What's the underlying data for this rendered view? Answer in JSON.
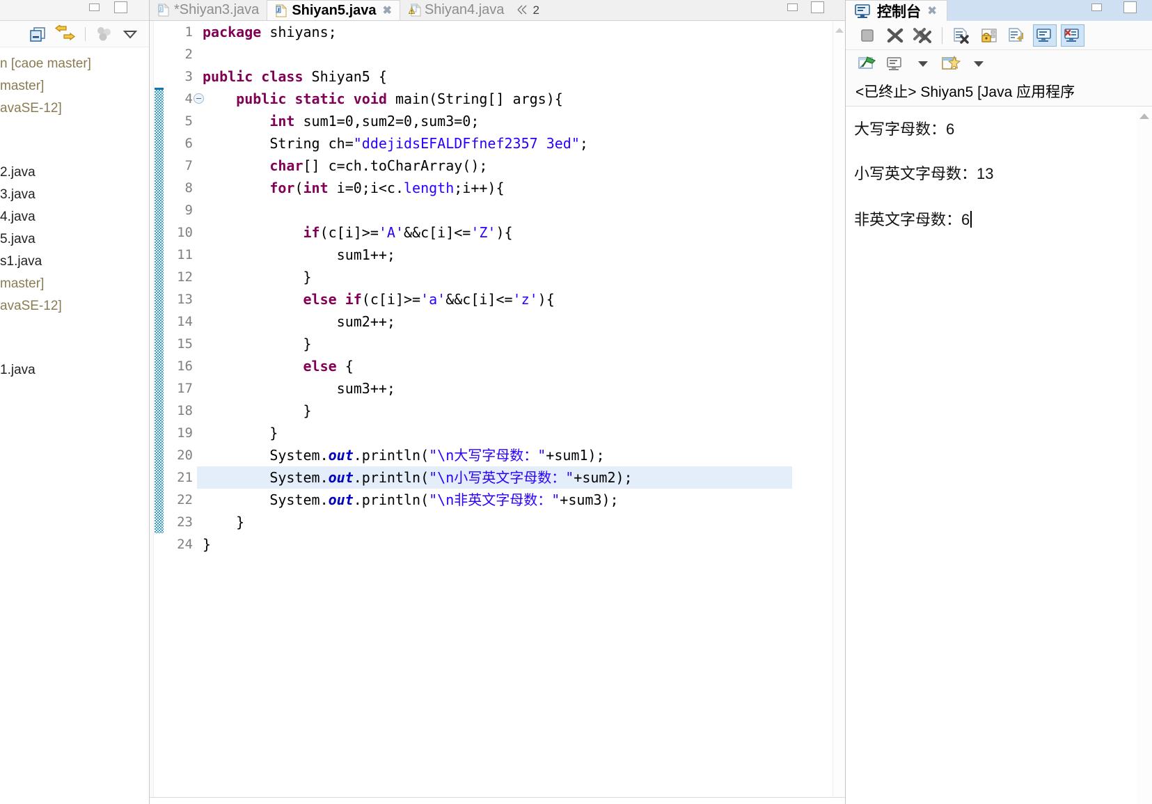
{
  "explorer": {
    "toolbar": [
      {
        "name": "collapse-all-icon",
        "label": "Collapse All"
      },
      {
        "name": "link-with-editor-icon",
        "label": "Link with Editor"
      },
      {
        "name": "view-menu-icon",
        "label": "View Menu"
      },
      {
        "name": "chevron-down-icon",
        "label": "More"
      }
    ],
    "tree": [
      {
        "label": "n [caoe master]",
        "style": "dim"
      },
      {
        "label": " master]",
        "style": "dim"
      },
      {
        "label": "avaSE-12]",
        "style": "dim"
      },
      {
        "label": "2.java",
        "style": "normal"
      },
      {
        "label": "3.java",
        "style": "normal"
      },
      {
        "label": "4.java",
        "style": "normal"
      },
      {
        "label": "5.java",
        "style": "selected"
      },
      {
        "label": "s1.java",
        "style": "normal"
      },
      {
        "label": " master]",
        "style": "dim"
      },
      {
        "label": "avaSE-12]",
        "style": "dim"
      },
      {
        "label": "1.java",
        "style": "normal"
      }
    ]
  },
  "editor": {
    "tabs": [
      {
        "label": "*Shiyan3.java",
        "active": false,
        "dirty": true,
        "warning": false,
        "closeable": false
      },
      {
        "label": "Shiyan5.java",
        "active": true,
        "dirty": false,
        "warning": false,
        "closeable": true
      },
      {
        "label": "Shiyan4.java",
        "active": false,
        "dirty": false,
        "warning": true,
        "closeable": false
      }
    ],
    "overflow_count": "2",
    "first_line": 1,
    "highlighted_line": 21,
    "change_bar_lines": [
      4,
      23
    ],
    "lines": [
      {
        "n": "1",
        "tokens": [
          {
            "t": "package ",
            "c": "kw"
          },
          {
            "t": "shiyans;",
            "c": "plain"
          }
        ]
      },
      {
        "n": "2",
        "tokens": []
      },
      {
        "n": "3",
        "tokens": [
          {
            "t": "public class ",
            "c": "kw"
          },
          {
            "t": "Shiyan5 {",
            "c": "plain"
          }
        ]
      },
      {
        "n": "4",
        "fold": true,
        "tokens": [
          {
            "t": "    ",
            "c": "plain"
          },
          {
            "t": "public static void ",
            "c": "kw"
          },
          {
            "t": "main(String[] args){",
            "c": "plain"
          }
        ]
      },
      {
        "n": "5",
        "tokens": [
          {
            "t": "        ",
            "c": "plain"
          },
          {
            "t": "int",
            "c": "kw"
          },
          {
            "t": " sum1=0,sum2=0,sum3=0;",
            "c": "plain"
          }
        ]
      },
      {
        "n": "6",
        "tokens": [
          {
            "t": "        String ch=",
            "c": "plain"
          },
          {
            "t": "\"ddejidsEFALDFfnef2357 3ed\"",
            "c": "str"
          },
          {
            "t": ";",
            "c": "plain"
          }
        ]
      },
      {
        "n": "7",
        "tokens": [
          {
            "t": "        ",
            "c": "plain"
          },
          {
            "t": "char",
            "c": "kw"
          },
          {
            "t": "[] c=ch.toCharArray();",
            "c": "plain"
          }
        ]
      },
      {
        "n": "8",
        "tokens": [
          {
            "t": "        ",
            "c": "plain"
          },
          {
            "t": "for",
            "c": "kw"
          },
          {
            "t": "(",
            "c": "plain"
          },
          {
            "t": "int",
            "c": "kw"
          },
          {
            "t": " i=0;i<c.",
            "c": "plain"
          },
          {
            "t": "length",
            "c": "str"
          },
          {
            "t": ";i++){",
            "c": "plain"
          }
        ]
      },
      {
        "n": "9",
        "tokens": []
      },
      {
        "n": "10",
        "tokens": [
          {
            "t": "            ",
            "c": "plain"
          },
          {
            "t": "if",
            "c": "kw"
          },
          {
            "t": "(c[i]>=",
            "c": "plain"
          },
          {
            "t": "'A'",
            "c": "str"
          },
          {
            "t": "&&c[i]<=",
            "c": "plain"
          },
          {
            "t": "'Z'",
            "c": "str"
          },
          {
            "t": "){",
            "c": "plain"
          }
        ]
      },
      {
        "n": "11",
        "tokens": [
          {
            "t": "                sum1++;",
            "c": "plain"
          }
        ]
      },
      {
        "n": "12",
        "tokens": [
          {
            "t": "            }",
            "c": "plain"
          }
        ]
      },
      {
        "n": "13",
        "tokens": [
          {
            "t": "            ",
            "c": "plain"
          },
          {
            "t": "else if",
            "c": "kw"
          },
          {
            "t": "(c[i]>=",
            "c": "plain"
          },
          {
            "t": "'a'",
            "c": "str"
          },
          {
            "t": "&&c[i]<=",
            "c": "plain"
          },
          {
            "t": "'z'",
            "c": "str"
          },
          {
            "t": "){",
            "c": "plain"
          }
        ]
      },
      {
        "n": "14",
        "tokens": [
          {
            "t": "                sum2++;",
            "c": "plain"
          }
        ]
      },
      {
        "n": "15",
        "tokens": [
          {
            "t": "            }",
            "c": "plain"
          }
        ]
      },
      {
        "n": "16",
        "tokens": [
          {
            "t": "            ",
            "c": "plain"
          },
          {
            "t": "else",
            "c": "kw"
          },
          {
            "t": " {",
            "c": "plain"
          }
        ]
      },
      {
        "n": "17",
        "tokens": [
          {
            "t": "                sum3++;",
            "c": "plain"
          }
        ]
      },
      {
        "n": "18",
        "tokens": [
          {
            "t": "            }",
            "c": "plain"
          }
        ]
      },
      {
        "n": "19",
        "tokens": [
          {
            "t": "        }",
            "c": "plain"
          }
        ]
      },
      {
        "n": "20",
        "tokens": [
          {
            "t": "        System.",
            "c": "plain"
          },
          {
            "t": "out",
            "c": "field"
          },
          {
            "t": ".println(",
            "c": "plain"
          },
          {
            "t": "\"\\n大写字母数：\"",
            "c": "str"
          },
          {
            "t": "+sum1);",
            "c": "plain"
          }
        ]
      },
      {
        "n": "21",
        "tokens": [
          {
            "t": "        System.",
            "c": "plain"
          },
          {
            "t": "out",
            "c": "field"
          },
          {
            "t": ".println(",
            "c": "plain"
          },
          {
            "t": "\"\\n小写英文字母数：\"",
            "c": "str"
          },
          {
            "t": "+sum2);",
            "c": "plain"
          }
        ]
      },
      {
        "n": "22",
        "tokens": [
          {
            "t": "        System.",
            "c": "plain"
          },
          {
            "t": "out",
            "c": "field"
          },
          {
            "t": ".println(",
            "c": "plain"
          },
          {
            "t": "\"\\n非英文字母数：\"",
            "c": "str"
          },
          {
            "t": "+sum3);",
            "c": "plain"
          }
        ]
      },
      {
        "n": "23",
        "tokens": [
          {
            "t": "    }",
            "c": "plain"
          }
        ]
      },
      {
        "n": "24",
        "tokens": [
          {
            "t": "}",
            "c": "plain"
          }
        ]
      }
    ]
  },
  "console": {
    "tab_label": "控制台",
    "toolbar_row1": [
      {
        "name": "terminate-icon",
        "label": "Terminate",
        "active": false
      },
      {
        "name": "remove-launch-icon",
        "label": "Remove Launch",
        "active": false
      },
      {
        "name": "remove-all-terminated-icon",
        "label": "Remove All Terminated Launches",
        "active": false
      },
      {
        "name": "clear-console-icon",
        "label": "Clear Console",
        "active": false
      },
      {
        "name": "scroll-lock-icon",
        "label": "Scroll Lock",
        "active": false
      },
      {
        "name": "word-wrap-icon",
        "label": "Word Wrap",
        "active": false
      },
      {
        "name": "show-on-stdout-icon",
        "label": "Show Console When Standard Out Changes",
        "active": true
      },
      {
        "name": "show-on-stderr-icon",
        "label": "Show Console When Standard Error Changes",
        "active": true
      }
    ],
    "toolbar_row2": [
      {
        "name": "pin-console-icon",
        "label": "Pin Console"
      },
      {
        "name": "display-selected-console-icon",
        "label": "Display Selected Console"
      },
      {
        "name": "chevron-down-icon",
        "label": "Console Select Menu"
      },
      {
        "name": "open-console-icon",
        "label": "Open Console"
      },
      {
        "name": "chevron-down-icon",
        "label": "Open Console Menu"
      }
    ],
    "launch_title": "<已终止> Shiyan5 [Java 应用程序",
    "output": [
      "大写字母数：6",
      "小写英文字母数：13",
      "非英文字母数：6"
    ]
  },
  "colors": {
    "keyword": "#7f0055",
    "string": "#2a00ff",
    "field": "#0000c0",
    "current_line": "#e4edfa",
    "change_bar": "#2f9fd0",
    "selection": "#d5d5d5",
    "toolbar_active": "#cfe4f7"
  }
}
